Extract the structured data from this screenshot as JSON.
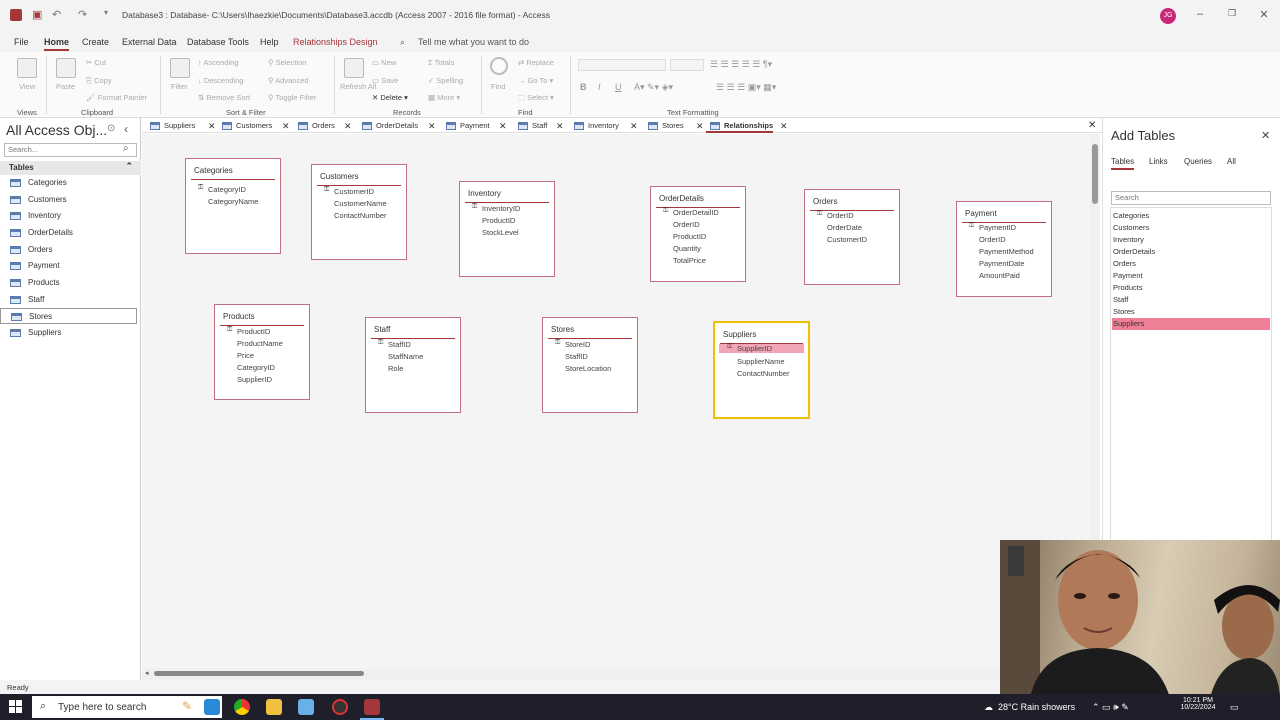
{
  "titlebar": {
    "title": "Database3 : Database- C:\\Users\\Ihaezkie\\Documents\\Database3.accdb (Access 2007 - 2016 file format) - Access",
    "avatar_initials": "JG"
  },
  "ribbon_tabs": [
    "File",
    "Home",
    "Create",
    "External Data",
    "Database Tools",
    "Help",
    "Relationships Design"
  ],
  "tell_me": "Tell me what you want to do",
  "ribbon": {
    "groups": [
      "Views",
      "Clipboard",
      "Sort & Filter",
      "Records",
      "Find",
      "Text Formatting"
    ],
    "view": "View",
    "paste": "Paste",
    "cut": "Cut",
    "copy": "Copy",
    "format_painter": "Format Painter",
    "filter": "Filter",
    "ascending": "Ascending",
    "descending": "Descending",
    "remove_sort": "Remove Sort",
    "selection": "Selection",
    "advanced": "Advanced",
    "toggle_filter": "Toggle Filter",
    "refresh_all": "Refresh All",
    "new": "New",
    "save": "Save",
    "delete": "Delete",
    "totals": "Totals",
    "spelling": "Spelling",
    "more": "More",
    "find": "Find",
    "replace": "Replace",
    "goto": "Go To",
    "select": "Select"
  },
  "nav": {
    "title": "All Access Obj...",
    "search_placeholder": "Search...",
    "section": "Tables",
    "items": [
      "Categories",
      "Customers",
      "Inventory",
      "OrderDetails",
      "Orders",
      "Payment",
      "Products",
      "Staff",
      "Stores",
      "Suppliers"
    ]
  },
  "doc_tabs": [
    "Suppliers",
    "Customers",
    "Orders",
    "OrderDetails",
    "Payment",
    "Staff",
    "Inventory",
    "Stores",
    "Relationships"
  ],
  "tables": [
    {
      "name": "Categories",
      "fields": [
        "CategoryID",
        "CategoryName"
      ]
    },
    {
      "name": "Customers",
      "fields": [
        "CustomerID",
        "CustomerName",
        "ContactNumber"
      ]
    },
    {
      "name": "Inventory",
      "fields": [
        "InventoryID",
        "ProductID",
        "StockLevel"
      ]
    },
    {
      "name": "OrderDetails",
      "fields": [
        "OrderDetailID",
        "OrderID",
        "ProductID",
        "Quantity",
        "TotalPrice"
      ]
    },
    {
      "name": "Orders",
      "fields": [
        "OrderID",
        "OrderDate",
        "CustomerID"
      ]
    },
    {
      "name": "Payment",
      "fields": [
        "PaymentID",
        "OrderID",
        "PaymentMethod",
        "PaymentDate",
        "AmountPaid"
      ]
    },
    {
      "name": "Products",
      "fields": [
        "ProductID",
        "ProductName",
        "Price",
        "CategoryID",
        "SupplierID"
      ]
    },
    {
      "name": "Staff",
      "fields": [
        "StaffID",
        "StaffName",
        "Role"
      ]
    },
    {
      "name": "Stores",
      "fields": [
        "StoreID",
        "StaffID",
        "StoreLocation"
      ]
    },
    {
      "name": "Suppliers",
      "fields": [
        "SupplierID",
        "SupplierName",
        "ContactNumber"
      ]
    }
  ],
  "add_tables": {
    "title": "Add Tables",
    "tabs": [
      "Tables",
      "Links",
      "Queries",
      "All"
    ],
    "search_placeholder": "Search",
    "items": [
      "Categories",
      "Customers",
      "Inventory",
      "OrderDetails",
      "Orders",
      "Payment",
      "Products",
      "Staff",
      "Stores",
      "Suppliers"
    ],
    "selected": "Suppliers"
  },
  "status": "Ready",
  "taskbar": {
    "search_placeholder": "Type here to search",
    "weather": "28°C  Rain showers",
    "time": "10:21 PM",
    "date": "10/22/2024"
  },
  "colors": {
    "accent": "#a4373a",
    "selection": "#ee7f95",
    "selected_border": "#f0c000"
  }
}
